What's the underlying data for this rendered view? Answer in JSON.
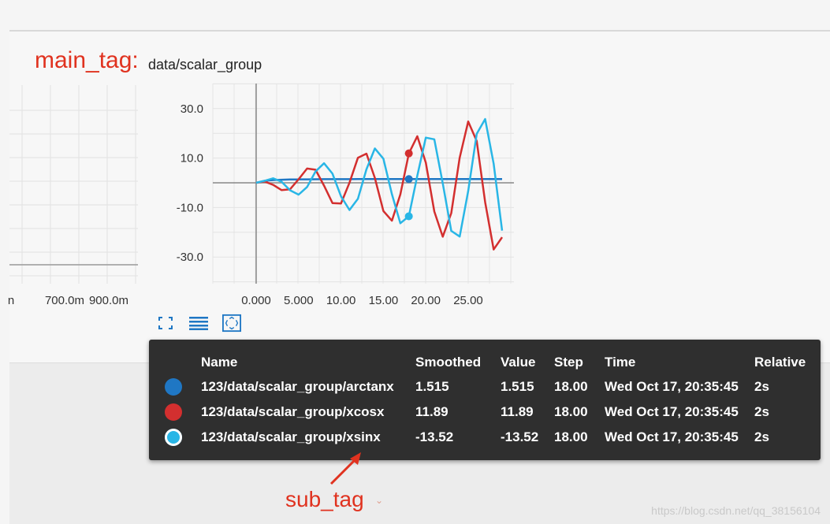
{
  "header": {
    "main_tag_label": "main_tag:",
    "tag_value": "data/scalar_group"
  },
  "left_chart": {
    "x_tick_labels": [
      "n",
      "700.0m",
      "900.0m"
    ]
  },
  "chart_data": {
    "type": "line",
    "xlim": [
      0,
      29
    ],
    "ylim": [
      -40,
      40
    ],
    "x_ticks": [
      "0.000",
      "5.000",
      "10.00",
      "15.00",
      "20.00",
      "25.00"
    ],
    "y_ticks": [
      "30.0",
      "10.0",
      "-10.0",
      "-30.0"
    ],
    "grid": true,
    "series": [
      {
        "name": "123/data/scalar_group/arctanx",
        "color": "#1f77c4",
        "x": [
          0,
          1,
          2,
          3,
          4,
          5,
          6,
          7,
          8,
          9,
          10,
          11,
          12,
          13,
          14,
          15,
          16,
          17,
          18,
          19,
          20,
          21,
          22,
          23,
          24,
          25,
          26,
          27,
          28,
          29
        ],
        "y": [
          0,
          0.79,
          1.11,
          1.25,
          1.33,
          1.37,
          1.41,
          1.43,
          1.45,
          1.46,
          1.47,
          1.48,
          1.49,
          1.49,
          1.5,
          1.5,
          1.51,
          1.51,
          1.515,
          1.52,
          1.52,
          1.52,
          1.53,
          1.53,
          1.53,
          1.53,
          1.53,
          1.53,
          1.54,
          1.54
        ]
      },
      {
        "name": "123/data/scalar_group/xcosx",
        "color": "#d32f2f",
        "x": [
          0,
          1,
          2,
          3,
          4,
          5,
          6,
          7,
          8,
          9,
          10,
          11,
          12,
          13,
          14,
          15,
          16,
          17,
          18,
          19,
          20,
          21,
          22,
          23,
          24,
          25,
          26,
          27,
          28,
          29
        ],
        "y": [
          0,
          0.54,
          -0.83,
          -2.97,
          -2.61,
          1.42,
          5.76,
          5.28,
          -1.16,
          -8.2,
          -8.39,
          0.05,
          10.13,
          11.79,
          1.93,
          -11.4,
          -15.32,
          -4.67,
          11.89,
          18.82,
          8.16,
          -11.59,
          -21.78,
          -12.25,
          10.16,
          24.78,
          16.87,
          -7.82,
          -26.94,
          -22.01
        ]
      },
      {
        "name": "123/data/scalar_group/xsinx",
        "color": "#29b6e6",
        "x": [
          0,
          1,
          2,
          3,
          4,
          5,
          6,
          7,
          8,
          9,
          10,
          11,
          12,
          13,
          14,
          15,
          16,
          17,
          18,
          19,
          20,
          21,
          22,
          23,
          24,
          25,
          26,
          27,
          28,
          29
        ],
        "y": [
          0,
          0.84,
          1.82,
          0.42,
          -3.03,
          -4.79,
          -1.68,
          4.6,
          7.91,
          3.71,
          -5.44,
          -11.0,
          -6.44,
          5.46,
          13.87,
          9.75,
          -4.6,
          -16.34,
          -13.52,
          2.85,
          18.26,
          17.57,
          -0.2,
          -19.44,
          -21.73,
          -3.31,
          19.77,
          25.76,
          7.7,
          -19.34
        ]
      }
    ],
    "hover_step": 18.0
  },
  "toolbar": {
    "expand_icon": "expand-icon",
    "legend_icon": "list-icon",
    "fit_icon": "fit-domain-icon"
  },
  "tooltip": {
    "headers": {
      "name": "Name",
      "smoothed": "Smoothed",
      "value": "Value",
      "step": "Step",
      "time": "Time",
      "relative": "Relative"
    },
    "rows": [
      {
        "color": "#1f77c4",
        "name": "123/data/scalar_group/arctanx",
        "smoothed": "1.515",
        "value": "1.515",
        "step": "18.00",
        "time": "Wed Oct 17, 20:35:45",
        "relative": "2s"
      },
      {
        "color": "#d32f2f",
        "name": "123/data/scalar_group/xcosx",
        "smoothed": "11.89",
        "value": "11.89",
        "step": "18.00",
        "time": "Wed Oct 17, 20:35:45",
        "relative": "2s"
      },
      {
        "color": "#29b6e6",
        "name": "123/data/scalar_group/xsinx",
        "smoothed": "-13.52",
        "value": "-13.52",
        "step": "18.00",
        "time": "Wed Oct 17, 20:35:45",
        "relative": "2s"
      }
    ]
  },
  "annotation": {
    "sub_tag_label": "sub_tag",
    "caret": "⌄"
  },
  "watermark": "https://blog.csdn.net/qq_38156104"
}
